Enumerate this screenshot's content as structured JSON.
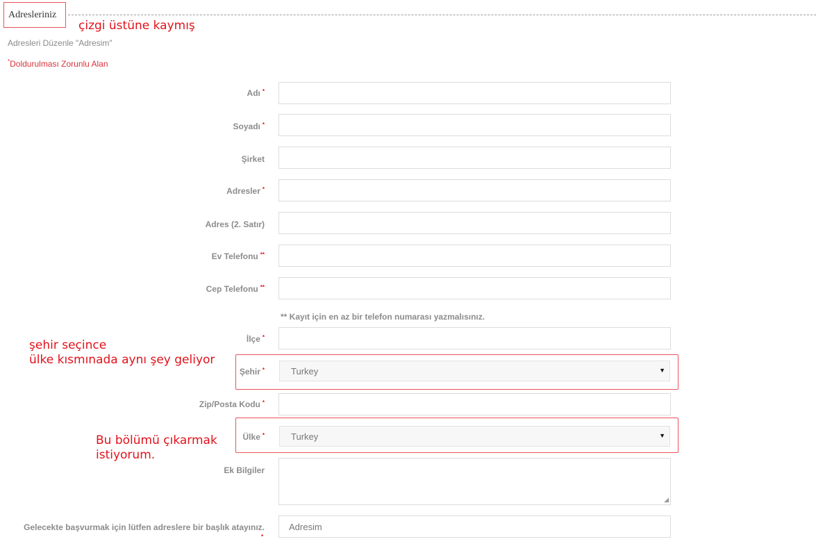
{
  "heading": "Adresleriniz",
  "subtitle": "Adresleri Düzenle \"Adresim\"",
  "required_note": {
    "marker": "*",
    "text": "Doldurulması Zorunlu Alan"
  },
  "phone_hint": "** Kayıt için en az bir telefon numarası yazmalısınız.",
  "annotations": {
    "top": "çizgi üstüne kaymış",
    "city": "şehir seçince\nülke kısmınada aynı şey geliyor",
    "country": "Bu bölümü çıkarmak\nistiyorum."
  },
  "fields": {
    "first_name": {
      "label": "Adı",
      "req": "*",
      "value": ""
    },
    "last_name": {
      "label": "Soyadı",
      "req": "*",
      "value": ""
    },
    "company": {
      "label": "Şirket",
      "value": ""
    },
    "address1": {
      "label": "Adresler",
      "req": "*",
      "value": ""
    },
    "address2": {
      "label": "Adres (2. Satır)",
      "value": ""
    },
    "home_phone": {
      "label": "Ev Telefonu",
      "req": "**",
      "value": ""
    },
    "mobile_phone": {
      "label": "Cep Telefonu",
      "req": "**",
      "value": ""
    },
    "district": {
      "label": "İlçe",
      "req": "*",
      "value": ""
    },
    "city": {
      "label": "Şehir",
      "req": "*",
      "selected": "Turkey"
    },
    "zip": {
      "label": "Zip/Posta Kodu",
      "req": "*",
      "value": ""
    },
    "country": {
      "label": "Ülke",
      "req": "*",
      "selected": "Turkey"
    },
    "additional": {
      "label": "Ek Bilgiler",
      "value": ""
    },
    "alias": {
      "label": "Gelecekte başvurmak için lütfen adreslere bir başlık atayınız.",
      "req": "*",
      "value": "Adresim"
    }
  },
  "icons": {
    "caret": "▼",
    "resize": "◢"
  },
  "colors": {
    "accent_red": "#e1121b",
    "highlight_border": "#e8525a",
    "label_gray": "#8c8c8c"
  }
}
